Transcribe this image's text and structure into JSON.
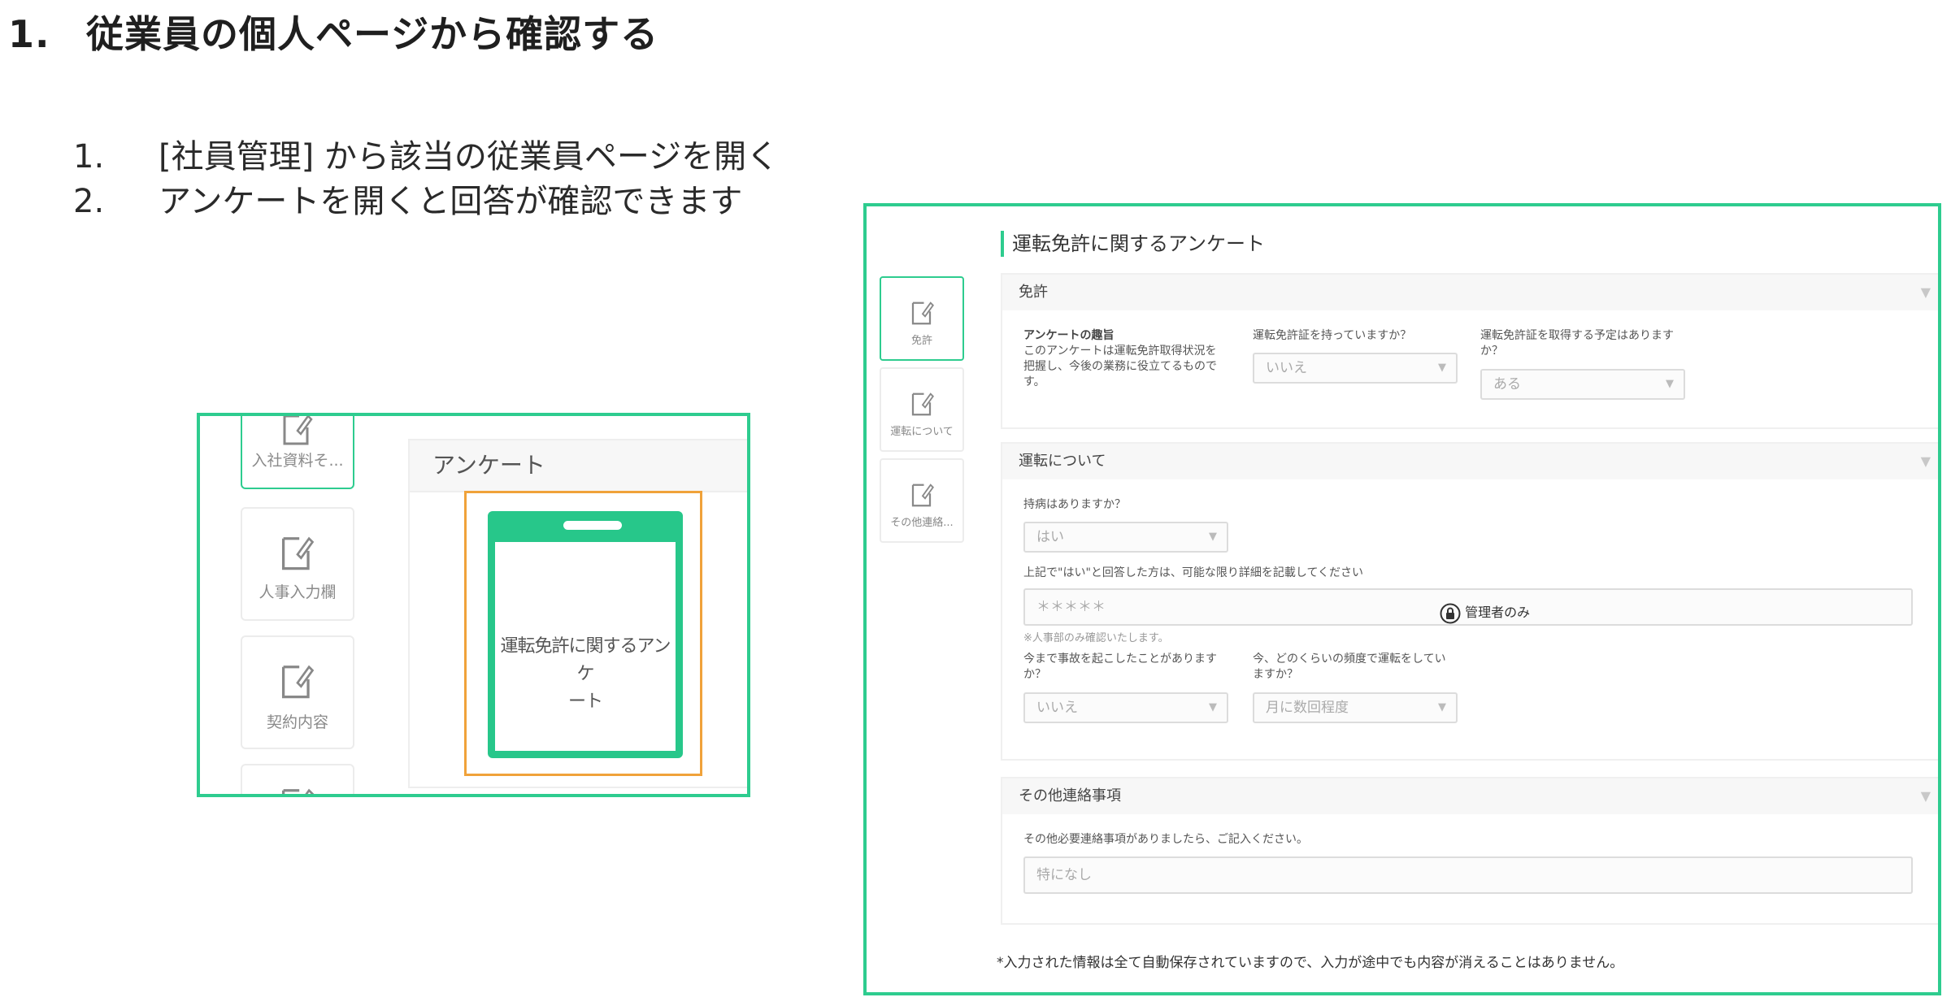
{
  "header": {
    "number": "1.",
    "title": "従業員の個人ページから確認する"
  },
  "steps": [
    {
      "num": "1.",
      "text": "[社員管理] から該当の従業員ページを開く"
    },
    {
      "num": "2.",
      "text": "アンケートを開くと回答が確認できます"
    }
  ],
  "left_shot": {
    "sidebar_items": [
      "入社資料そ...",
      "人事入力欄",
      "契約内容"
    ],
    "panel_title": "アンケート",
    "card_title_line1": "運転免許に関するアンケ",
    "card_title_line2": "ート"
  },
  "right_shot": {
    "form_title": "運転免許に関するアンケート",
    "side_tabs": [
      "免許",
      "運転について",
      "その他連絡..."
    ],
    "sections": {
      "license": {
        "title": "免許",
        "purpose_heading": "アンケートの趣旨",
        "purpose_text_1": "このアンケートは運転免許取得状況を",
        "purpose_text_2": "把握し、今後の業務に役立てるもので",
        "purpose_text_3": "す。",
        "q1": "運転免許証を持っていますか？",
        "a1": "いいえ",
        "q2_line1": "運転免許証を取得する予定はあります",
        "q2_line2": "か？",
        "a2": "ある"
      },
      "driving": {
        "title": "運転について",
        "q1": "持病はありますか？",
        "a1": "はい",
        "q2": "上記で\"はい\"と回答した方は、可能な限り詳細を記載してください",
        "a2_masked": "＊＊＊＊＊",
        "admin_only": "管理者のみ",
        "note": "※人事部のみ確認いたします。",
        "q3_line1": "今まで事故を起こしたことがあります",
        "q3_line2": "か？",
        "a3": "いいえ",
        "q4_line1": "今、どのくらいの頻度で運転をしてい",
        "q4_line2": "ますか？",
        "a4": "月に数回程度"
      },
      "other": {
        "title": "その他連絡事項",
        "q1": "その他必要連絡事項がありましたら、ご記入ください。",
        "a1": "特になし"
      }
    },
    "footer_note": "*入力された情報は全て自動保存されていますので、入力が途中でも内容が消えることはありません。"
  }
}
